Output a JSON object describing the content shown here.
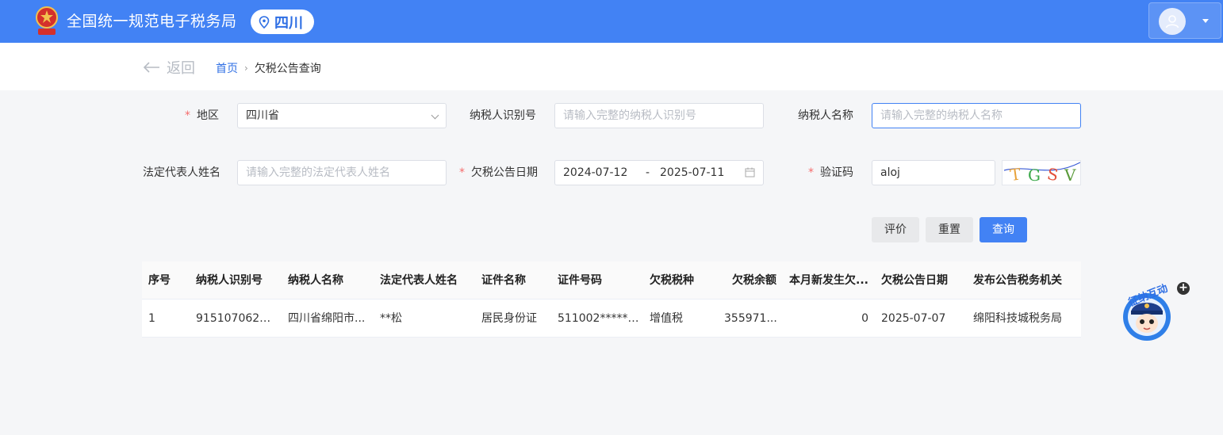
{
  "header": {
    "site_title": "全国统一规范电子税务局",
    "region": "四川"
  },
  "breadcrumb": {
    "back_label": "返回",
    "home": "首页",
    "separator": "›",
    "current": "欠税公告查询"
  },
  "form": {
    "region": {
      "label": "地区",
      "required": "*",
      "value": "四川省"
    },
    "taxpayer_id": {
      "label": "纳税人识别号",
      "placeholder": "请输入完整的纳税人识别号"
    },
    "taxpayer_name": {
      "label": "纳税人名称",
      "placeholder": "请输入完整的纳税人名称"
    },
    "legal_rep": {
      "label": "法定代表人姓名",
      "placeholder": "请输入完整的法定代表人姓名"
    },
    "notice_date": {
      "label": "欠税公告日期",
      "required": "*",
      "start": "2024-07-12",
      "separator": "-",
      "end": "2025-07-11"
    },
    "captcha": {
      "label": "验证码",
      "required": "*",
      "value": "aloj",
      "image_text": "TGSV"
    }
  },
  "buttons": {
    "evaluate": "评价",
    "reset": "重置",
    "query": "查询"
  },
  "table": {
    "columns": [
      "序号",
      "纳税人识别号",
      "纳税人名称",
      "法定代表人姓名",
      "证件名称",
      "证件号码",
      "欠税税种",
      "欠税余额",
      "本月新发生欠...",
      "欠税公告日期",
      "发布公告税务机关"
    ],
    "rows": [
      [
        "1",
        "9151070620...",
        "四川省绵阳市...",
        "**松",
        "居民身份证",
        "511002******...",
        "增值税",
        "355971...",
        "0",
        "2025-07-07",
        "绵阳科技城税务局"
      ]
    ]
  },
  "assistant": {
    "label": "征纳互动",
    "badge": "+"
  },
  "colors": {
    "brand_blue": "#4282f4",
    "required_red": "#f56c6c"
  }
}
